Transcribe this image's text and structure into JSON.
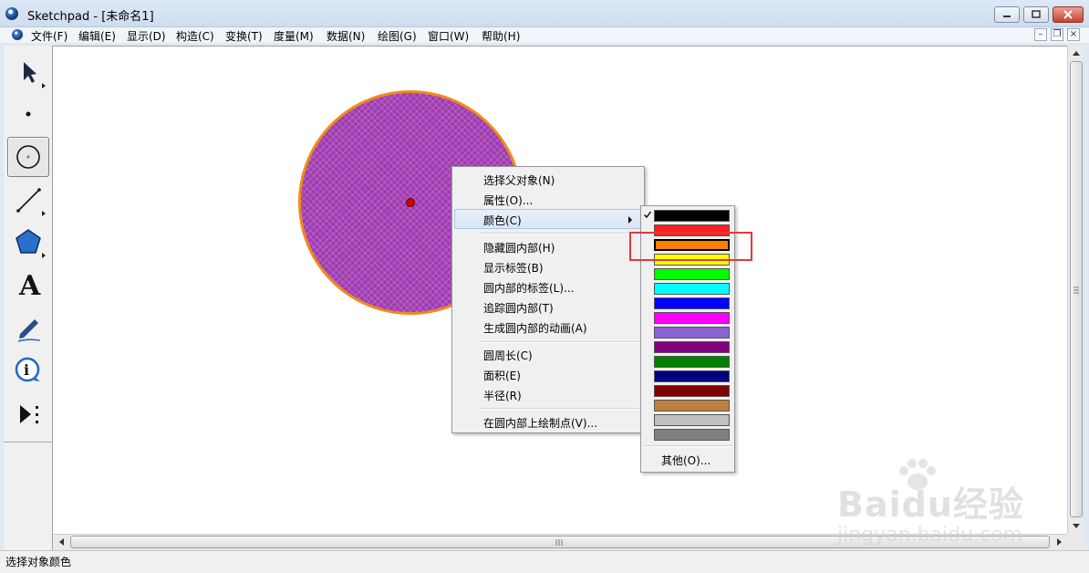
{
  "window": {
    "title": "Sketchpad  - [未命名1]"
  },
  "menubar": {
    "items": [
      "文件(F)",
      "编辑(E)",
      "显示(D)",
      "构造(C)",
      "变换(T)",
      "度量(M)",
      "数据(N)",
      "绘图(G)",
      "窗口(W)",
      "帮助(H)"
    ]
  },
  "toolbar": {
    "tools": [
      "arrow-select-tool",
      "point-tool",
      "compass-tool",
      "straightedge-tool",
      "polygon-tool",
      "text-tool",
      "marker-tool",
      "information-tool",
      "custom-tool"
    ],
    "active_tool": "compass-tool"
  },
  "context_menu": {
    "items": [
      {
        "label": "选择父对象(N)"
      },
      {
        "label": "属性(O)..."
      },
      {
        "label": "颜色(C)",
        "submenu": true,
        "highlighted": true
      },
      {
        "label": "隐藏圆内部(H)"
      },
      {
        "label": "显示标签(B)"
      },
      {
        "label": "圆内部的标签(L)..."
      },
      {
        "label": "追踪圆内部(T)"
      },
      {
        "label": "生成圆内部的动画(A)"
      },
      {
        "label": "圆周长(C)"
      },
      {
        "label": "面积(E)"
      },
      {
        "label": "半径(R)"
      },
      {
        "label": "在圆内部上绘制点(V)..."
      }
    ]
  },
  "color_menu": {
    "swatches": [
      "#000000",
      "#ff2020",
      "#ff7f00",
      "#ffff00",
      "#00ff00",
      "#00ffff",
      "#0000ff",
      "#ff00ff",
      "#8a63d2",
      "#800080",
      "#008000",
      "#000080",
      "#800000",
      "#c08040",
      "#c0c0c0",
      "#808080"
    ],
    "selected_index": 2,
    "other_label": "其他(O)..."
  },
  "colors": {
    "circle_fill": "#9b3db5",
    "circle_border": "#f28a17",
    "center_point": "#d40000",
    "annotation_box": "#e03a3a"
  },
  "statusbar": {
    "text": "选择对象颜色"
  },
  "watermark": {
    "line1": "Baidu经验",
    "line2": "jingyan.baidu.com"
  }
}
